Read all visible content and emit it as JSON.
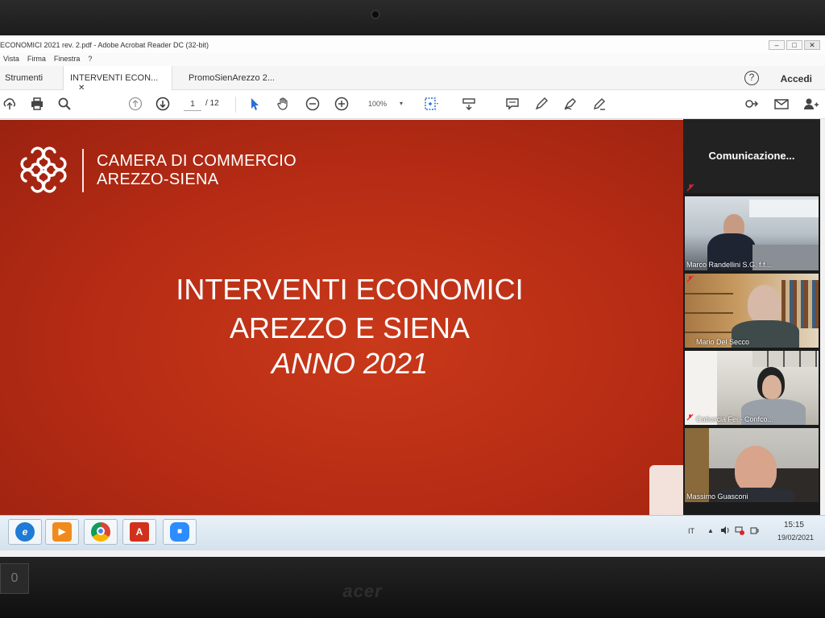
{
  "window": {
    "title": "ECONOMICI 2021 rev. 2.pdf - Adobe Acrobat Reader DC (32-bit)",
    "btn_min": "–",
    "btn_max": "□",
    "btn_close": "✕"
  },
  "menu": [
    "Vista",
    "Firma",
    "Finestra",
    "?"
  ],
  "tabs": {
    "tools": "Strumenti",
    "active": "INTERVENTI ECON...",
    "active_close": "✕",
    "other": "PromoSienArezzo 2..."
  },
  "header": {
    "help": "?",
    "accedi": "Accedi"
  },
  "toolbar": {
    "page_current": "1",
    "page_total": "/ 12",
    "zoom": "100%",
    "zoom_caret": "▾"
  },
  "slide": {
    "org_line1": "CAMERA DI COMMERCIO",
    "org_line2": "AREZZO-SIENA",
    "headline1": "INTERVENTI ECONOMICI",
    "headline2": "AREZZO E SIENA",
    "headline3": "ANNO 2021"
  },
  "video_panel": {
    "title": "Comunicazione...",
    "participants": [
      {
        "name": "Marco Randellini S.G. f.f...."
      },
      {
        "name": "Mario Del Secco"
      },
      {
        "name": "Catiuscia Fei - Confco..."
      },
      {
        "name": "Massimo Guasconi"
      }
    ]
  },
  "taskbar": {
    "apps": [
      {
        "name": "internet-explorer",
        "glyph": "e"
      },
      {
        "name": "media-player",
        "glyph": "▶"
      },
      {
        "name": "chrome",
        "glyph": ""
      },
      {
        "name": "acrobat",
        "glyph": "A"
      },
      {
        "name": "zoom",
        "glyph": "■"
      }
    ],
    "lang": "IT",
    "tray_caret": "▲",
    "time": "15:15",
    "date": "19/02/2021"
  },
  "bezel": {
    "brand": "acer",
    "sticker": "0"
  },
  "colors": {
    "slide_red": "#b52b14",
    "acrobat_red": "#d0311d",
    "zoom_blue": "#2d8cff",
    "ie_blue": "#1e7bd6",
    "mic_muted": "#e22233"
  }
}
